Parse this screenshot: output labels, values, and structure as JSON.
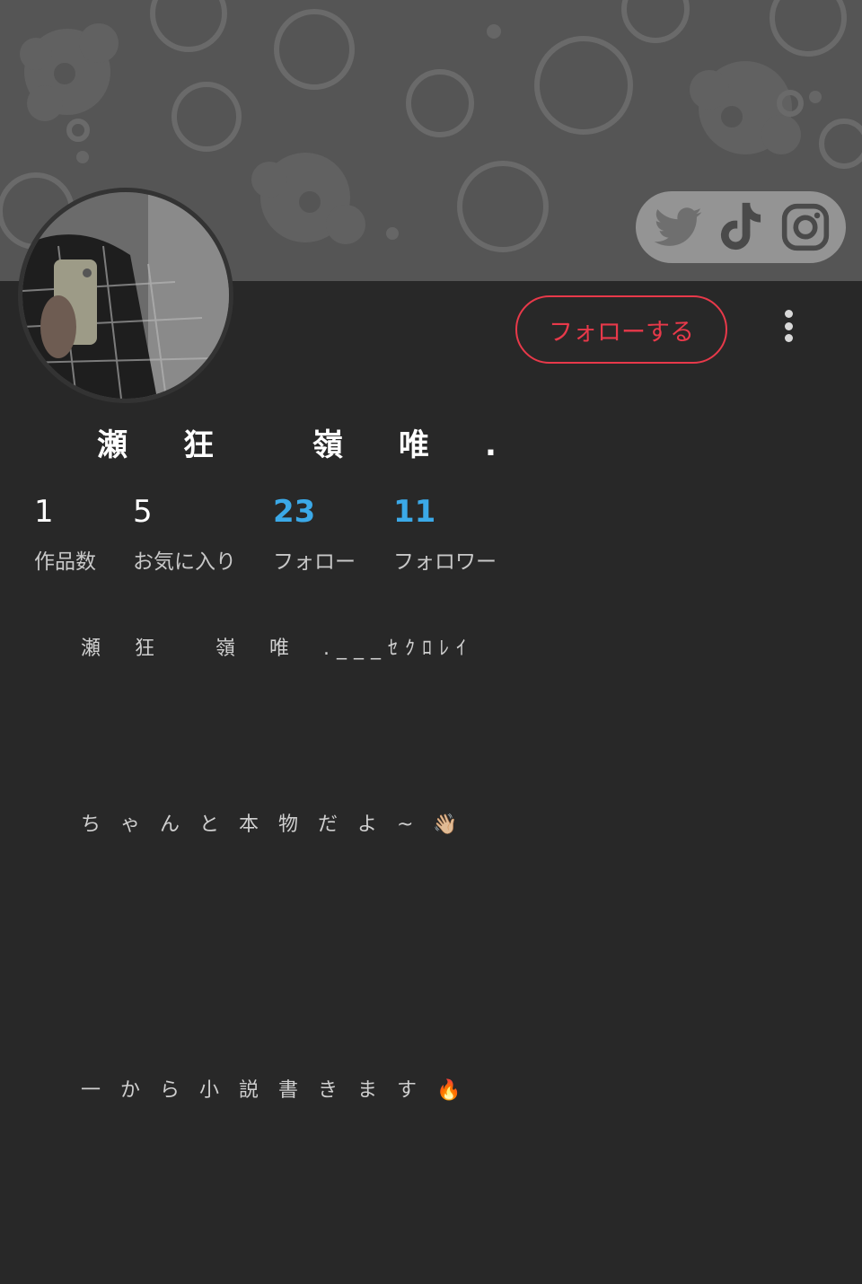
{
  "profile": {
    "name": "瀬　狂　　嶺　唯　.",
    "follow_button": "フォローする"
  },
  "stats": [
    {
      "value": "1",
      "label": "作品数"
    },
    {
      "value": "5",
      "label": "お気に入り"
    },
    {
      "value": "23",
      "label": "フォロー"
    },
    {
      "value": "11",
      "label": "フォロワー"
    }
  ],
  "bio": {
    "line1": "瀬　狂　　嶺　唯　.___ｾｸﾛﾚｲ",
    "line2": "ちゃんと本物だよ~👋🏼",
    "line3": "一から小説書きます🔥"
  },
  "social": [
    "twitter-icon",
    "tiktok-icon",
    "instagram-icon"
  ],
  "colors": {
    "accent_red": "#e8394a",
    "link_blue": "#3ba9e8",
    "background": "#282828",
    "header": "#555555"
  }
}
